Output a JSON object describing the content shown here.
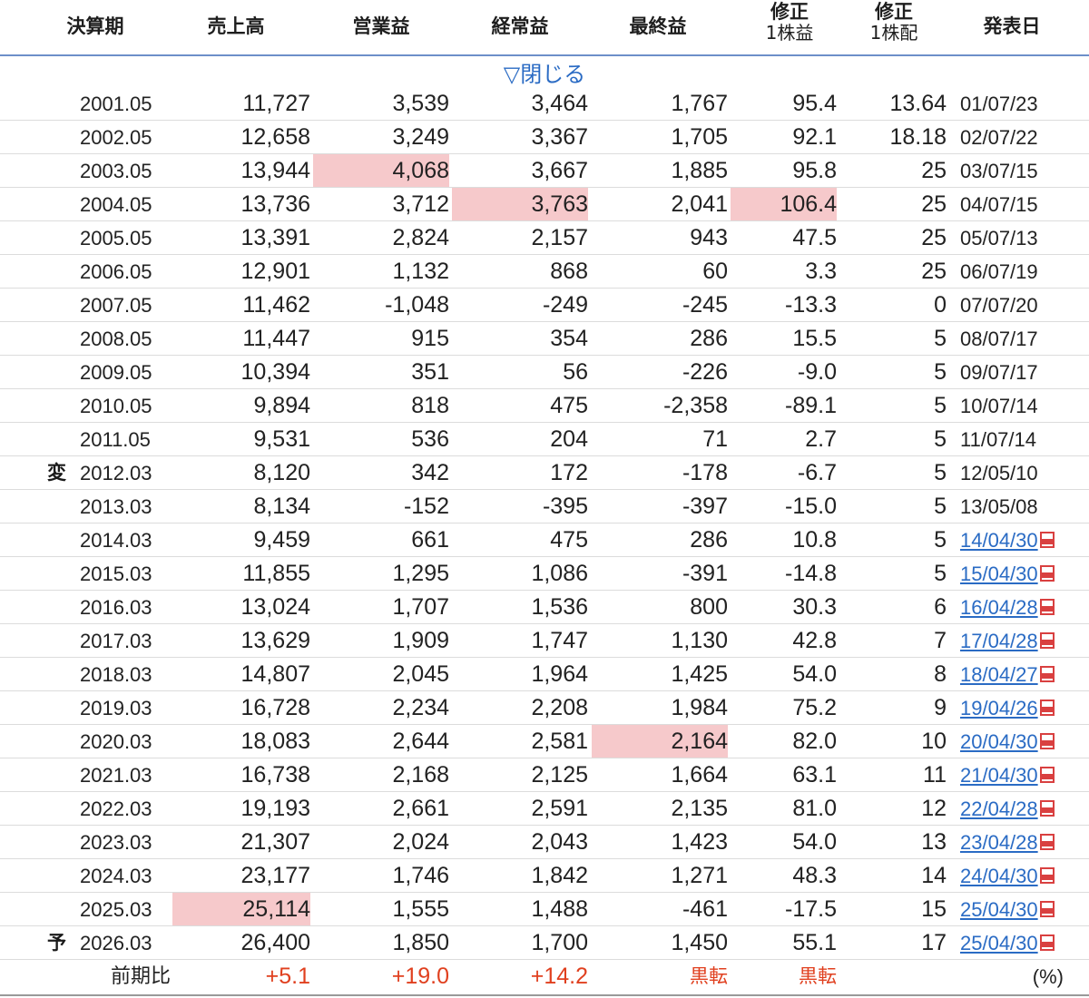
{
  "header": {
    "period": "決算期",
    "sales": "売上高",
    "operating": "営業益",
    "ordinary": "経常益",
    "net": "最終益",
    "eps_top": "修正",
    "eps_bottom": "1株益",
    "div_top": "修正",
    "div_bottom": "1株配",
    "date": "発表日"
  },
  "toggle_label": "▽閉じる",
  "rows": [
    {
      "mark": "",
      "period": "2001.05",
      "sales": "11,727",
      "operating": "3,539",
      "ordinary": "3,464",
      "net": "1,767",
      "eps": "95.4",
      "div": "13.64",
      "date": "01/07/23",
      "link": false
    },
    {
      "mark": "",
      "period": "2002.05",
      "sales": "12,658",
      "operating": "3,249",
      "ordinary": "3,367",
      "net": "1,705",
      "eps": "92.1",
      "div": "18.18",
      "date": "02/07/22",
      "link": false
    },
    {
      "mark": "",
      "period": "2003.05",
      "sales": "13,944",
      "operating": "4,068",
      "ordinary": "3,667",
      "net": "1,885",
      "eps": "95.8",
      "div": "25",
      "date": "03/07/15",
      "link": false,
      "hl": [
        "operating"
      ]
    },
    {
      "mark": "",
      "period": "2004.05",
      "sales": "13,736",
      "operating": "3,712",
      "ordinary": "3,763",
      "net": "2,041",
      "eps": "106.4",
      "div": "25",
      "date": "04/07/15",
      "link": false,
      "hl": [
        "ordinary",
        "eps"
      ]
    },
    {
      "mark": "",
      "period": "2005.05",
      "sales": "13,391",
      "operating": "2,824",
      "ordinary": "2,157",
      "net": "943",
      "eps": "47.5",
      "div": "25",
      "date": "05/07/13",
      "link": false
    },
    {
      "mark": "",
      "period": "2006.05",
      "sales": "12,901",
      "operating": "1,132",
      "ordinary": "868",
      "net": "60",
      "eps": "3.3",
      "div": "25",
      "date": "06/07/19",
      "link": false
    },
    {
      "mark": "",
      "period": "2007.05",
      "sales": "11,462",
      "operating": "-1,048",
      "ordinary": "-249",
      "net": "-245",
      "eps": "-13.3",
      "div": "0",
      "date": "07/07/20",
      "link": false
    },
    {
      "mark": "",
      "period": "2008.05",
      "sales": "11,447",
      "operating": "915",
      "ordinary": "354",
      "net": "286",
      "eps": "15.5",
      "div": "5",
      "date": "08/07/17",
      "link": false
    },
    {
      "mark": "",
      "period": "2009.05",
      "sales": "10,394",
      "operating": "351",
      "ordinary": "56",
      "net": "-226",
      "eps": "-9.0",
      "div": "5",
      "date": "09/07/17",
      "link": false
    },
    {
      "mark": "",
      "period": "2010.05",
      "sales": "9,894",
      "operating": "818",
      "ordinary": "475",
      "net": "-2,358",
      "eps": "-89.1",
      "div": "5",
      "date": "10/07/14",
      "link": false
    },
    {
      "mark": "",
      "period": "2011.05",
      "sales": "9,531",
      "operating": "536",
      "ordinary": "204",
      "net": "71",
      "eps": "2.7",
      "div": "5",
      "date": "11/07/14",
      "link": false
    },
    {
      "mark": "変",
      "period": "2012.03",
      "sales": "8,120",
      "operating": "342",
      "ordinary": "172",
      "net": "-178",
      "eps": "-6.7",
      "div": "5",
      "date": "12/05/10",
      "link": false
    },
    {
      "mark": "",
      "period": "2013.03",
      "sales": "8,134",
      "operating": "-152",
      "ordinary": "-395",
      "net": "-397",
      "eps": "-15.0",
      "div": "5",
      "date": "13/05/08",
      "link": false
    },
    {
      "mark": "",
      "period": "2014.03",
      "sales": "9,459",
      "operating": "661",
      "ordinary": "475",
      "net": "286",
      "eps": "10.8",
      "div": "5",
      "date": "14/04/30",
      "link": true
    },
    {
      "mark": "",
      "period": "2015.03",
      "sales": "11,855",
      "operating": "1,295",
      "ordinary": "1,086",
      "net": "-391",
      "eps": "-14.8",
      "div": "5",
      "date": "15/04/30",
      "link": true
    },
    {
      "mark": "",
      "period": "2016.03",
      "sales": "13,024",
      "operating": "1,707",
      "ordinary": "1,536",
      "net": "800",
      "eps": "30.3",
      "div": "6",
      "date": "16/04/28",
      "link": true
    },
    {
      "mark": "",
      "period": "2017.03",
      "sales": "13,629",
      "operating": "1,909",
      "ordinary": "1,747",
      "net": "1,130",
      "eps": "42.8",
      "div": "7",
      "date": "17/04/28",
      "link": true
    },
    {
      "mark": "",
      "period": "2018.03",
      "sales": "14,807",
      "operating": "2,045",
      "ordinary": "1,964",
      "net": "1,425",
      "eps": "54.0",
      "div": "8",
      "date": "18/04/27",
      "link": true
    },
    {
      "mark": "",
      "period": "2019.03",
      "sales": "16,728",
      "operating": "2,234",
      "ordinary": "2,208",
      "net": "1,984",
      "eps": "75.2",
      "div": "9",
      "date": "19/04/26",
      "link": true
    },
    {
      "mark": "",
      "period": "2020.03",
      "sales": "18,083",
      "operating": "2,644",
      "ordinary": "2,581",
      "net": "2,164",
      "eps": "82.0",
      "div": "10",
      "date": "20/04/30",
      "link": true,
      "hl": [
        "net"
      ]
    },
    {
      "mark": "",
      "period": "2021.03",
      "sales": "16,738",
      "operating": "2,168",
      "ordinary": "2,125",
      "net": "1,664",
      "eps": "63.1",
      "div": "11",
      "date": "21/04/30",
      "link": true
    },
    {
      "mark": "",
      "period": "2022.03",
      "sales": "19,193",
      "operating": "2,661",
      "ordinary": "2,591",
      "net": "2,135",
      "eps": "81.0",
      "div": "12",
      "date": "22/04/28",
      "link": true
    },
    {
      "mark": "",
      "period": "2023.03",
      "sales": "21,307",
      "operating": "2,024",
      "ordinary": "2,043",
      "net": "1,423",
      "eps": "54.0",
      "div": "13",
      "date": "23/04/28",
      "link": true
    },
    {
      "mark": "",
      "period": "2024.03",
      "sales": "23,177",
      "operating": "1,746",
      "ordinary": "1,842",
      "net": "1,271",
      "eps": "48.3",
      "div": "14",
      "date": "24/04/30",
      "link": true
    },
    {
      "mark": "",
      "period": "2025.03",
      "sales": "25,114",
      "operating": "1,555",
      "ordinary": "1,488",
      "net": "-461",
      "eps": "-17.5",
      "div": "15",
      "date": "25/04/30",
      "link": true,
      "hl": [
        "sales"
      ]
    },
    {
      "mark": "予",
      "period": "2026.03",
      "sales": "26,400",
      "operating": "1,850",
      "ordinary": "1,700",
      "net": "1,450",
      "eps": "55.1",
      "div": "17",
      "date": "25/04/30",
      "link": true
    }
  ],
  "footer": {
    "label": "前期比",
    "sales": "+5.1",
    "operating": "+19.0",
    "ordinary": "+14.2",
    "net": "黒転",
    "eps": "黒転",
    "unit": "(%)"
  },
  "colors": {
    "highlight": "#f6c9cb",
    "link": "#2a6bc4",
    "change_red": "#e0401f"
  },
  "icons": {
    "pdf": "pdf-icon"
  }
}
